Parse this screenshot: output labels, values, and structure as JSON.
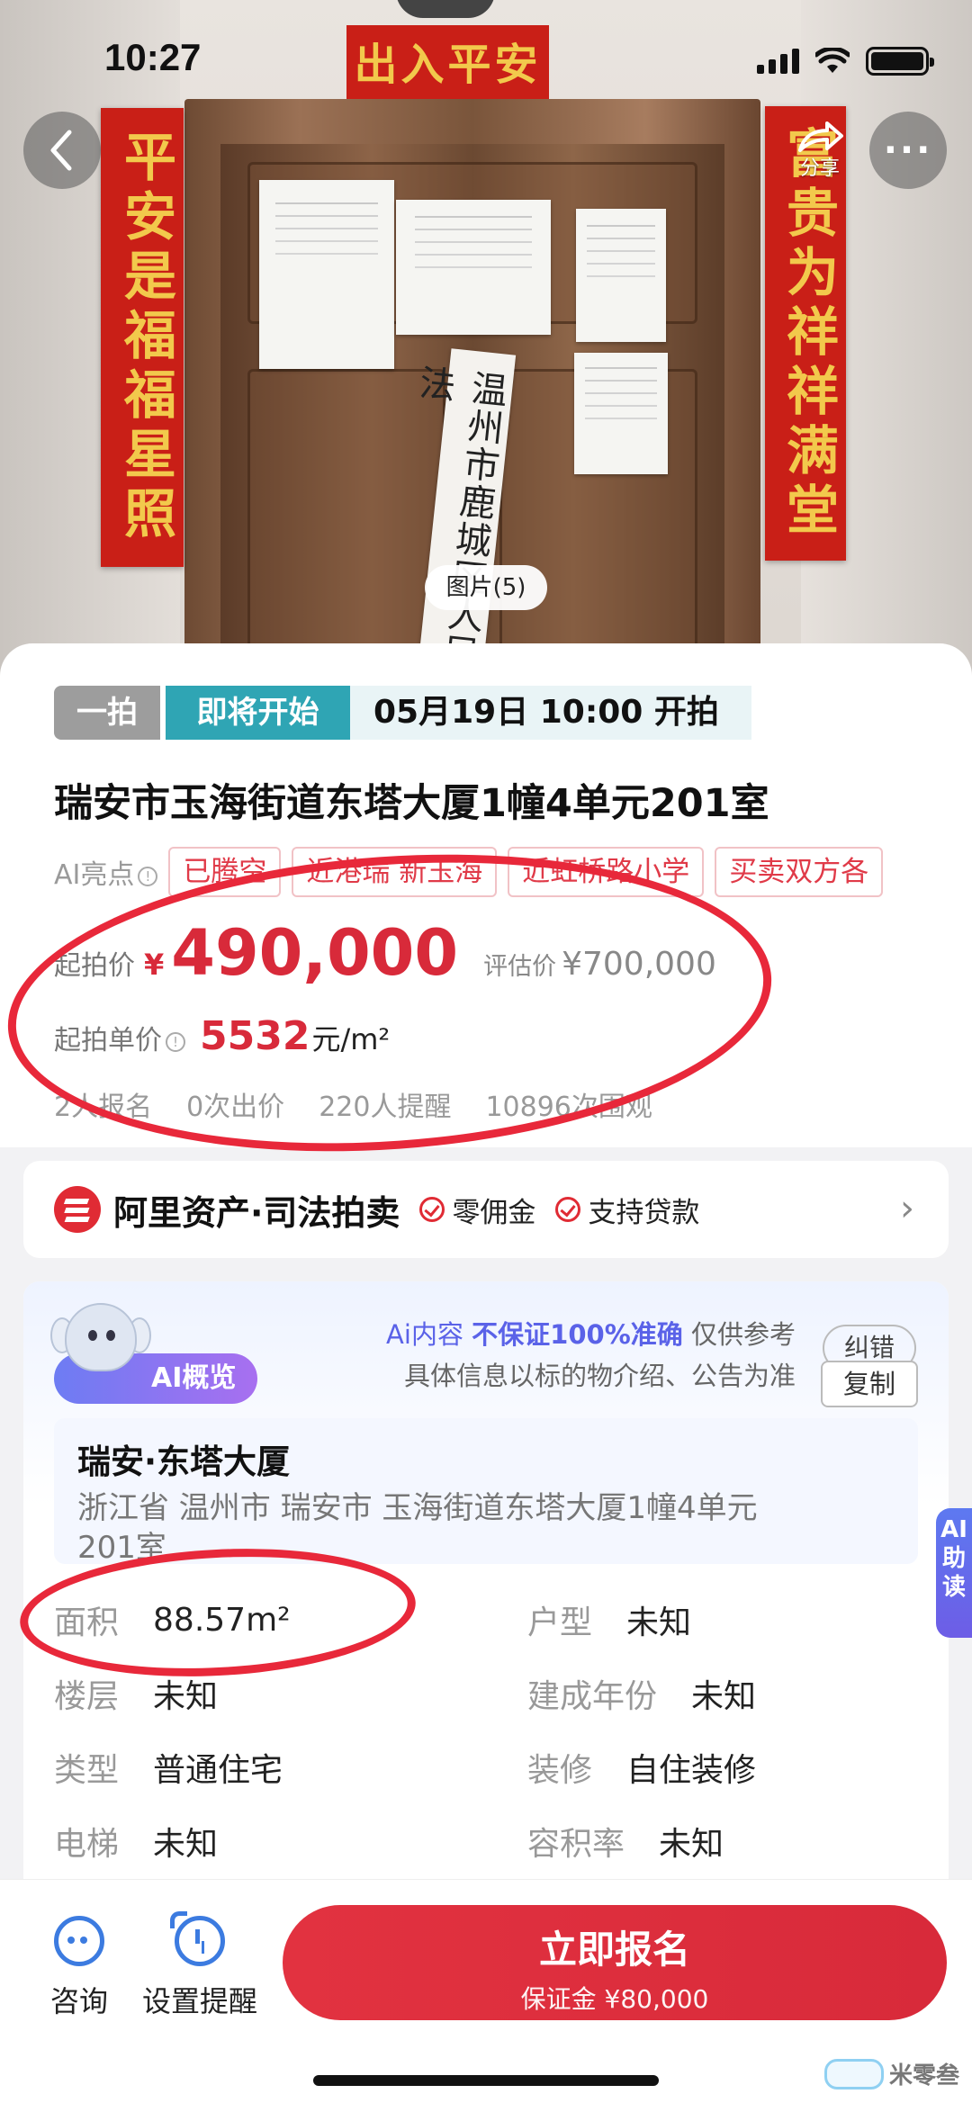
{
  "status_bar": {
    "time": "10:27"
  },
  "hero": {
    "hengpi": "出入平安",
    "couplet_left": "平安是福福星照",
    "couplet_right": "富贵为祥祥满堂",
    "seal_strip": "温州市鹿城区人民法",
    "share_label": "分享",
    "more_label": "···",
    "photo_count": "图片(5)"
  },
  "auction": {
    "round_tag": "一拍",
    "status_tag": "即将开始",
    "start_time": "05月19日 10:00 开拍",
    "title": "瑞安市玉海街道东塔大厦1幢4单元201室",
    "ai_label": "AI亮点",
    "highlights": [
      "已腾空",
      "近港瑞 新玉海",
      "近虹桥路小学",
      "买卖双方各"
    ],
    "start_price_label": "起拍价",
    "currency": "¥",
    "start_price": "490,000",
    "eval_label": "评估价",
    "eval_price": "¥700,000",
    "unit_price_label": "起拍单价",
    "unit_price": "5532",
    "unit_price_unit": "元/m²",
    "stats": [
      "2人报名",
      "0次出价",
      "220人提醒",
      "10896次围观"
    ]
  },
  "brand": {
    "name": "阿里资产·司法拍卖",
    "perks": [
      "零佣金",
      "支持贷款"
    ],
    "chevron": "›"
  },
  "ai_overview": {
    "badge": "AI概览",
    "note_prefix": "Ai内容",
    "note_strong": "不保证100%准确",
    "note_suffix": "仅供参考",
    "note_line2": "具体信息以标的物介绍、公告为准",
    "correct_button": "纠错",
    "addr_title": "瑞安·东塔大厦",
    "addr_text": "浙江省 温州市 瑞安市 玉海街道东塔大厦1幢4单元201室",
    "copy_button": "复制",
    "properties": [
      {
        "key": "面积",
        "value": "88.57m²"
      },
      {
        "key": "户型",
        "value": "未知"
      },
      {
        "key": "楼层",
        "value": "未知"
      },
      {
        "key": "建成年份",
        "value": "未知"
      },
      {
        "key": "类型",
        "value": "普通住宅"
      },
      {
        "key": "装修",
        "value": "自住装修"
      },
      {
        "key": "电梯",
        "value": "未知"
      },
      {
        "key": "容积率",
        "value": "未知"
      }
    ],
    "side_tab": "AI助读"
  },
  "bottom_bar": {
    "consult_label": "咨询",
    "reminder_label": "设置提醒",
    "signup_label": "立即报名",
    "deposit_text": "保证金 ¥80,000"
  },
  "watermark": {
    "text": "米零叁"
  },
  "colors": {
    "accent_red": "#d82a3a",
    "teal_tag": "#2fa5b4",
    "ai_purple": "#6d7cf3",
    "icon_blue": "#3c7be0"
  }
}
